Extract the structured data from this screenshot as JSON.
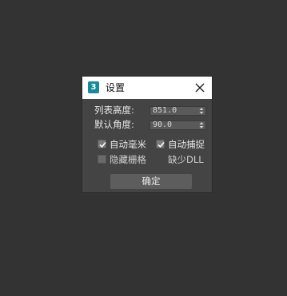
{
  "dialog": {
    "title": "设置",
    "app_icon_glyph": "3",
    "app_icon_color": "#1a8a9b",
    "close_icon": "close-icon"
  },
  "fields": [
    {
      "label": "列表高度:",
      "value": "851.0"
    },
    {
      "label": "默认角度:",
      "value": "90.0"
    }
  ],
  "checkboxes": [
    {
      "label": "自动毫米",
      "checked": true
    },
    {
      "label": "自动捕捉",
      "checked": true
    },
    {
      "label": "隐藏栅格",
      "checked": false
    },
    {
      "label": "缺少DLL",
      "checked": false
    }
  ],
  "buttons": {
    "ok_label": "确定"
  },
  "colors": {
    "background": "#333333",
    "dialog_body": "#444444",
    "titlebar": "#ffffff",
    "button": "#5d5d5d"
  }
}
